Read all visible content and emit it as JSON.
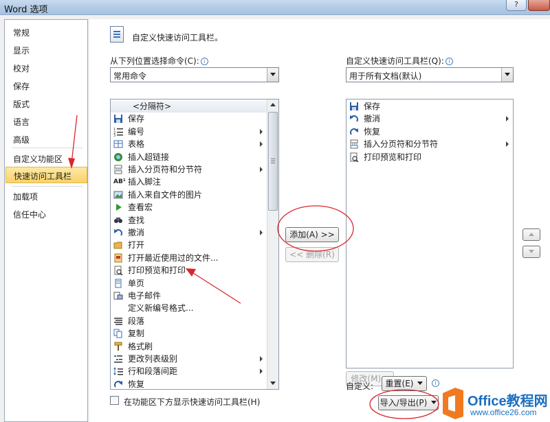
{
  "window": {
    "title": "Word 选项",
    "help_glyph": "?"
  },
  "sidebar": {
    "items": [
      {
        "label": "常规"
      },
      {
        "label": "显示"
      },
      {
        "label": "校对"
      },
      {
        "label": "保存"
      },
      {
        "label": "版式"
      },
      {
        "label": "语言"
      },
      {
        "label": "高级"
      },
      {
        "label": "自定义功能区"
      },
      {
        "label": "快速访问工具栏",
        "selected": true
      },
      {
        "label": "加载项"
      },
      {
        "label": "信任中心"
      }
    ]
  },
  "main": {
    "section_title": "自定义快速访问工具栏。",
    "choose_from_label": "从下列位置选择命令(C):",
    "choose_from_value": "常用命令",
    "customize_label": "自定义快速访问工具栏(Q):",
    "customize_value": "用于所有文档(默认)",
    "info_glyph": "i",
    "available_commands": [
      {
        "label": "<分隔符>",
        "icon": "none",
        "separator": true
      },
      {
        "label": "保存",
        "icon": "save-icon"
      },
      {
        "label": "编号",
        "icon": "numbering-icon",
        "submenu": true
      },
      {
        "label": "表格",
        "icon": "table-icon",
        "submenu": true
      },
      {
        "label": "插入超链接",
        "icon": "hyperlink-icon"
      },
      {
        "label": "插入分页符和分节符",
        "icon": "page-break-icon",
        "submenu": true
      },
      {
        "label": "插入脚注",
        "icon": "footnote-icon",
        "glyph": "AB¹"
      },
      {
        "label": "插入来自文件的图片",
        "icon": "picture-icon"
      },
      {
        "label": "查看宏",
        "icon": "macro-icon"
      },
      {
        "label": "查找",
        "icon": "find-icon"
      },
      {
        "label": "撤消",
        "icon": "undo-icon",
        "submenu": true
      },
      {
        "label": "打开",
        "icon": "open-folder-icon"
      },
      {
        "label": "打开最近使用过的文件...",
        "icon": "recent-file-icon"
      },
      {
        "label": "打印预览和打印",
        "icon": "print-preview-icon"
      },
      {
        "label": "单页",
        "icon": "one-page-icon"
      },
      {
        "label": "电子邮件",
        "icon": "email-icon"
      },
      {
        "label": "定义新编号格式...",
        "icon": "none"
      },
      {
        "label": "段落",
        "icon": "paragraph-icon"
      },
      {
        "label": "复制",
        "icon": "copy-icon"
      },
      {
        "label": "格式刷",
        "icon": "format-painter-icon"
      },
      {
        "label": "更改列表级别",
        "icon": "list-level-icon",
        "submenu": true
      },
      {
        "label": "行和段落间距",
        "icon": "line-spacing-icon",
        "submenu": true
      },
      {
        "label": "恢复",
        "icon": "redo-icon"
      }
    ],
    "toolbar_commands": [
      {
        "label": "保存",
        "icon": "save-icon"
      },
      {
        "label": "撤消",
        "icon": "undo-icon",
        "submenu": true
      },
      {
        "label": "恢复",
        "icon": "redo-icon"
      },
      {
        "label": "插入分页符和分节符",
        "icon": "page-break-icon",
        "submenu": true
      },
      {
        "label": "打印预览和打印",
        "icon": "print-preview-icon"
      }
    ],
    "add_button": "添加(A) >>",
    "remove_button": "<< 删除(R)",
    "modify_button": "修改(M)...",
    "customizations_label": "自定义:",
    "reset_button": "重置(E)",
    "import_export_button": "导入/导出(P)",
    "show_below_ribbon_label": "在功能区下方显示快速访问工具栏(H)"
  },
  "watermark": {
    "brand": "Office教程网",
    "url": "www.office26.com"
  },
  "colors": {
    "selection": "#f9d36a",
    "annotation": "#d9262c",
    "logo_orange": "#f07a1f",
    "logo_blue": "#1a6fc0"
  }
}
